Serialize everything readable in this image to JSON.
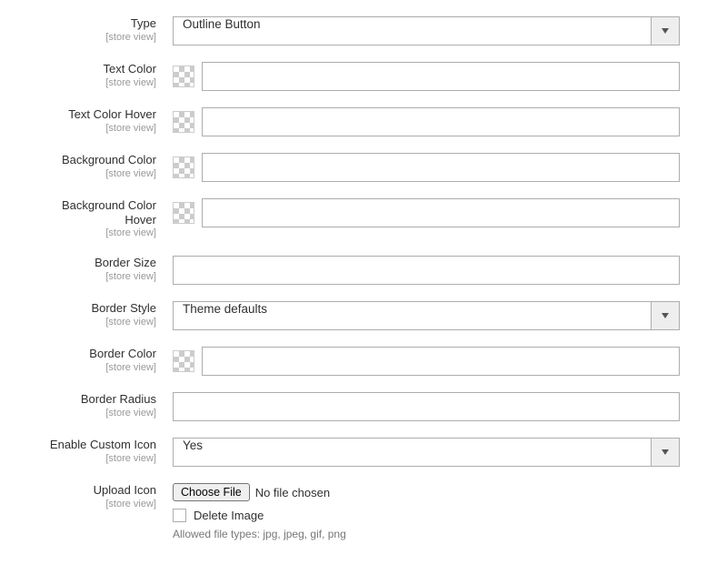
{
  "scope_label": "[store view]",
  "fields": {
    "type": {
      "label": "Type",
      "value": "Outline Button"
    },
    "text_color": {
      "label": "Text Color",
      "value": ""
    },
    "text_color_hover": {
      "label": "Text Color Hover",
      "value": ""
    },
    "background_color": {
      "label": "Background Color",
      "value": ""
    },
    "background_color_hover": {
      "label": "Background Color Hover",
      "value": ""
    },
    "border_size": {
      "label": "Border Size",
      "value": ""
    },
    "border_style": {
      "label": "Border Style",
      "value": "Theme defaults"
    },
    "border_color": {
      "label": "Border Color",
      "value": ""
    },
    "border_radius": {
      "label": "Border Radius",
      "value": ""
    },
    "enable_custom_icon": {
      "label": "Enable Custom Icon",
      "value": "Yes"
    },
    "upload_icon": {
      "label": "Upload Icon",
      "choose_label": "Choose File",
      "status": "No file chosen",
      "delete_label": "Delete Image",
      "hint": "Allowed file types: jpg, jpeg, gif, png"
    }
  }
}
